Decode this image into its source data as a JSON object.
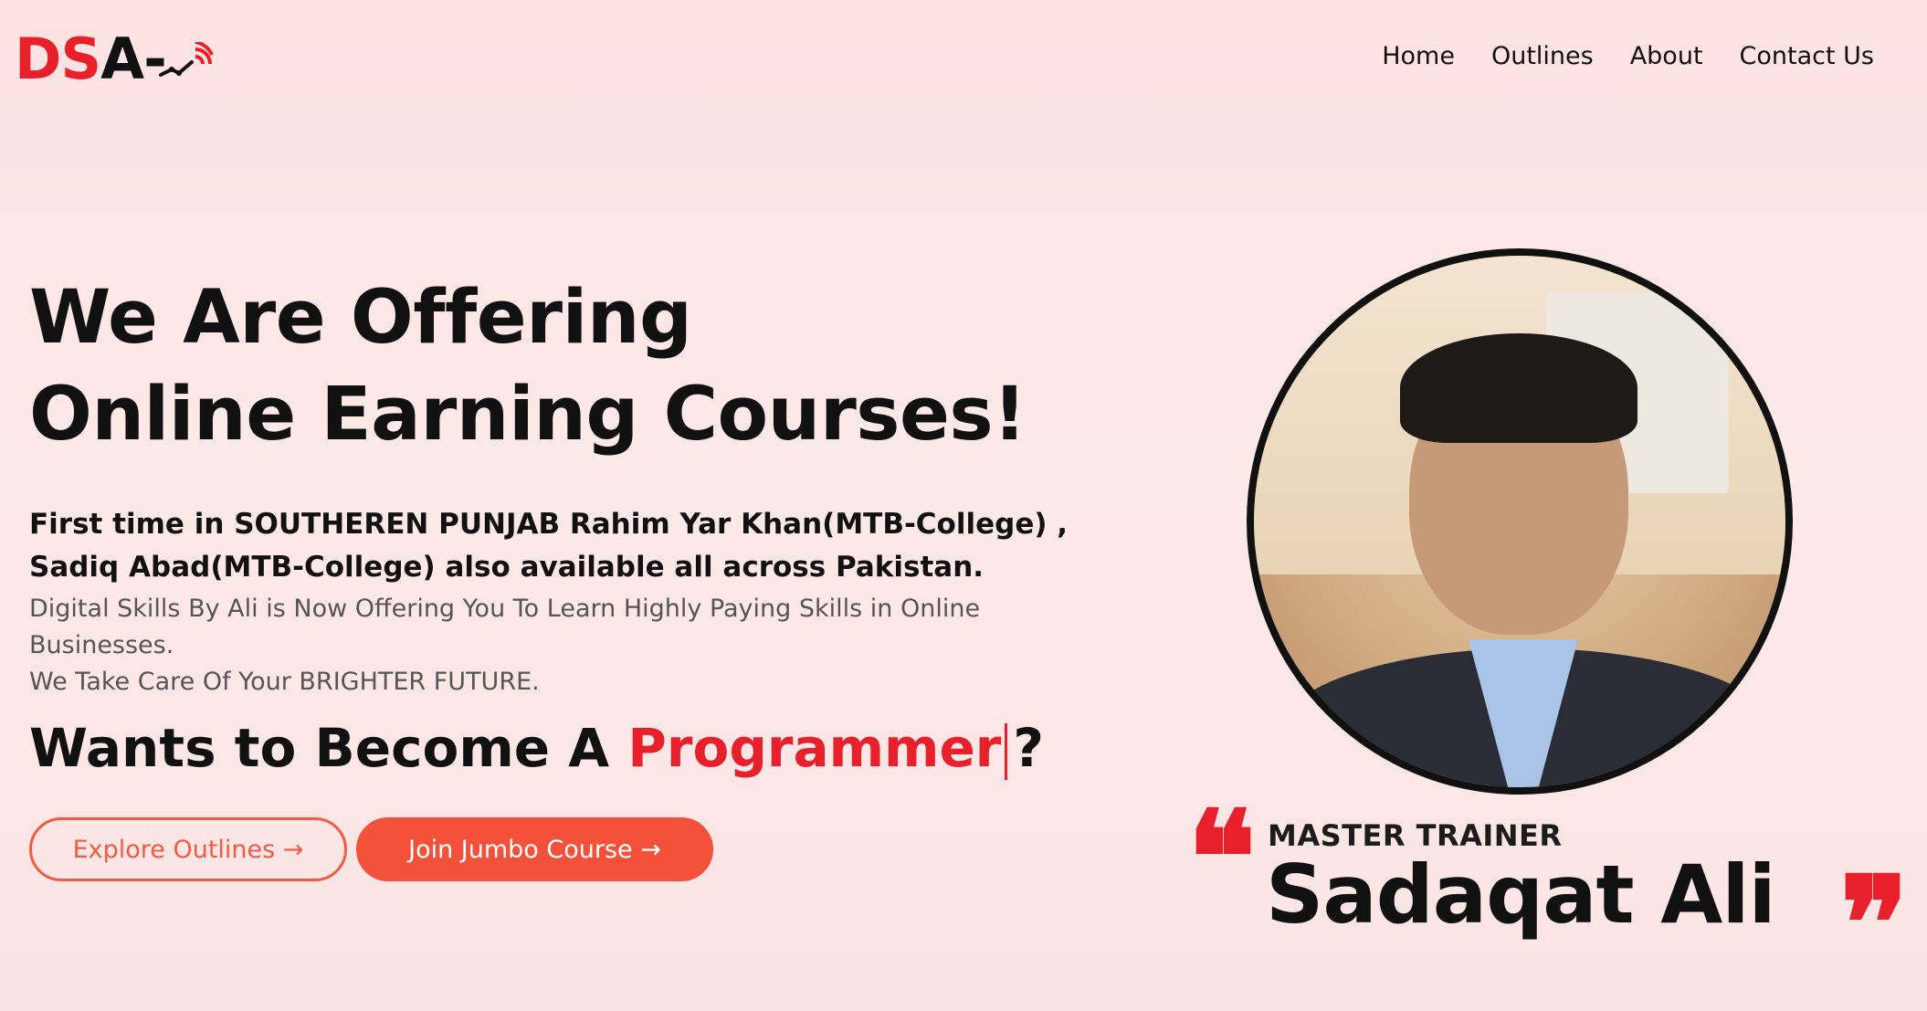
{
  "logo": {
    "part1": "DS",
    "part2": "A-"
  },
  "nav": {
    "items": [
      {
        "label": "Home"
      },
      {
        "label": "Outlines"
      },
      {
        "label": "About"
      },
      {
        "label": "Contact Us"
      }
    ]
  },
  "hero": {
    "title_line1": "We Are Offering",
    "title_line2": "Online Earning Courses!",
    "highlight_line1": "First time in SOUTHEREN PUNJAB Rahim Yar Khan(MTB-College) ,",
    "highlight_line2": "Sadiq Abad(MTB-College) also available all across Pakistan.",
    "desc_line1": "Digital Skills By Ali is Now Offering You To Learn Highly Paying Skills in Online",
    "desc_line2": "Businesses.",
    "desc_line3": "We Take Care Of Your BRIGHTER FUTURE.",
    "typing_prefix": "Wants to Become A ",
    "typing_word": "Programmer",
    "typing_suffix": "?"
  },
  "buttons": {
    "explore": "Explore Outlines →",
    "join": "Join Jumbo Course →"
  },
  "trainer": {
    "role": "MASTER TRAINER",
    "name": "Sadaqat Ali",
    "quote_open": "❝",
    "quote_close": "❞"
  },
  "colors": {
    "accent": "#e8202b",
    "button": "#f4513b",
    "background": "#fde4e4"
  }
}
